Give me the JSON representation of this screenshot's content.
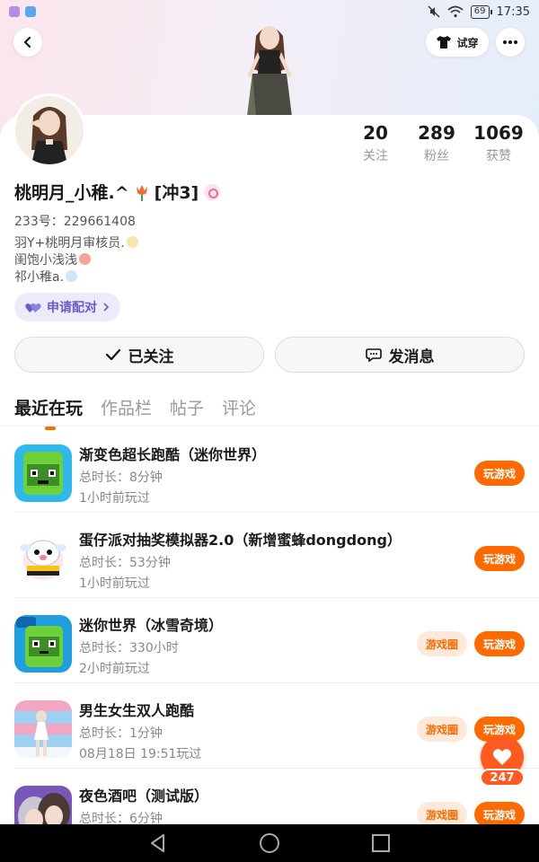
{
  "status_bar": {
    "time": "17:35",
    "battery": "69"
  },
  "header": {
    "try_on_label": "试穿"
  },
  "profile": {
    "nickname": "桃明月_小稚.^",
    "nickname_suffix": "[冲3]",
    "uid": "233号：229661408",
    "bio_lines": [
      "羽Y+桃明月审核员.",
      "闺饱小浅浅",
      "祁小稚a."
    ],
    "stats": [
      {
        "value": "20",
        "label": "关注"
      },
      {
        "value": "289",
        "label": "粉丝"
      },
      {
        "value": "1069",
        "label": "获赞"
      }
    ],
    "pair_button": "申请配对",
    "followed_button": "已关注",
    "message_button": "发消息"
  },
  "tabs": [
    "最近在玩",
    "作品栏",
    "帖子",
    "评论"
  ],
  "games": [
    {
      "title": "渐变色超长跑酷（迷你世界）",
      "duration": "总时长：8分钟",
      "last_played": "1小时前玩过",
      "has_circle": false
    },
    {
      "title": "蛋仔派对抽奖模拟器2.0（新增蜜蜂dongdong）",
      "duration": "总时长：53分钟",
      "last_played": "1小时前玩过",
      "has_circle": false
    },
    {
      "title": "迷你世界（冰雪奇境）",
      "duration": "总时长：330小时",
      "last_played": "2小时前玩过",
      "has_circle": true
    },
    {
      "title": "男生女生双人跑酷",
      "duration": "总时长：1分钟",
      "last_played": "08月18日 19:51玩过",
      "has_circle": true
    },
    {
      "title": "夜色酒吧（测试版）",
      "duration": "总时长：6分钟",
      "last_played": "",
      "has_circle": true
    }
  ],
  "buttons": {
    "play": "玩游戏",
    "circle": "游戏圈"
  },
  "like_count": "247",
  "colors": {
    "accent": "#ff6a00",
    "pair_bg": "#ecebfb",
    "pair_text": "#6a5ccb"
  }
}
